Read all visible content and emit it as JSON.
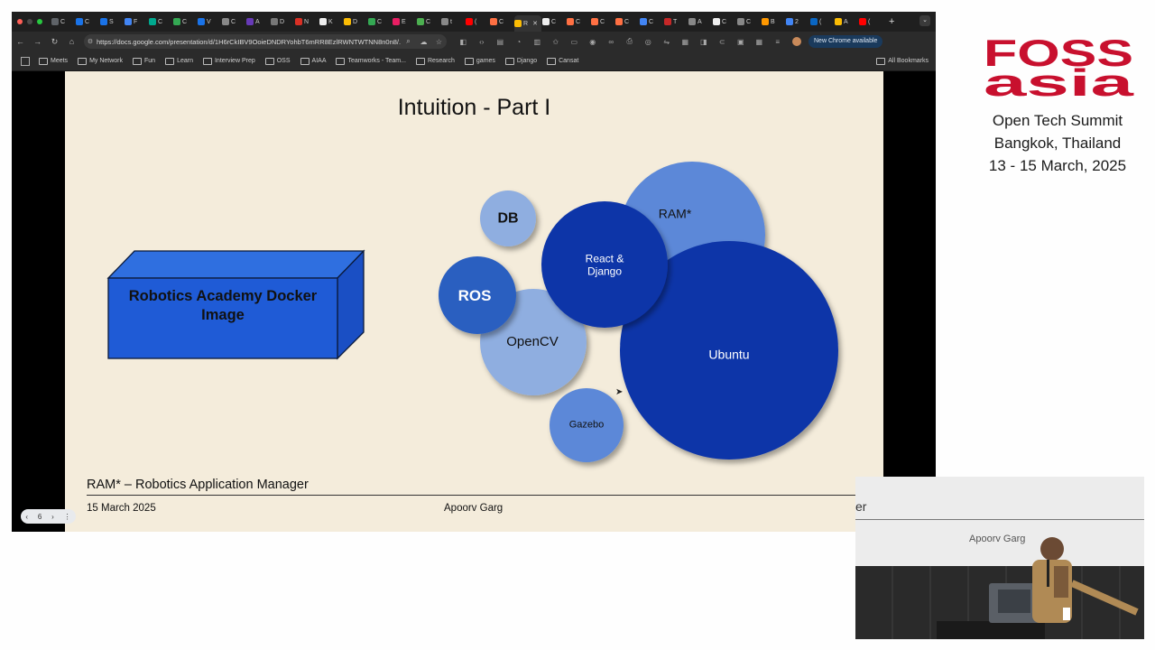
{
  "browser": {
    "tabs": [
      {
        "letter": "C",
        "color": "#5f6368"
      },
      {
        "letter": "C",
        "color": "#1a73e8"
      },
      {
        "letter": "S",
        "color": "#1a73e8"
      },
      {
        "letter": "F",
        "color": "#4285f4"
      },
      {
        "letter": "C",
        "color": "#00a98f"
      },
      {
        "letter": "C",
        "color": "#34a853"
      },
      {
        "letter": "V",
        "color": "#1a73e8"
      },
      {
        "letter": "C",
        "color": "#888888"
      },
      {
        "letter": "A",
        "color": "#673ab7"
      },
      {
        "letter": "D",
        "color": "#777777"
      },
      {
        "letter": "N",
        "color": "#d93025"
      },
      {
        "letter": "K",
        "color": "#eeeeee"
      },
      {
        "letter": "D",
        "color": "#fbbc04"
      },
      {
        "letter": "C",
        "color": "#34a853"
      },
      {
        "letter": "E",
        "color": "#e91e63"
      },
      {
        "letter": "C",
        "color": "#4caf50"
      },
      {
        "letter": "t",
        "color": "#888888"
      },
      {
        "letter": "(",
        "color": "#ff0000"
      },
      {
        "letter": "C",
        "color": "#ff7043"
      },
      {
        "letter": "R",
        "color": "#fbbc04",
        "active": true
      },
      {
        "letter": "C",
        "color": "#eeeeee"
      },
      {
        "letter": "C",
        "color": "#ff7043"
      },
      {
        "letter": "C",
        "color": "#ff7043"
      },
      {
        "letter": "C",
        "color": "#ff7043"
      },
      {
        "letter": "C",
        "color": "#4285f4"
      },
      {
        "letter": "T",
        "color": "#c62828"
      },
      {
        "letter": "A",
        "color": "#888888"
      },
      {
        "letter": "C",
        "color": "#eeeeee"
      },
      {
        "letter": "C",
        "color": "#888888"
      },
      {
        "letter": "B",
        "color": "#ff9800"
      },
      {
        "letter": "2",
        "color": "#4285f4"
      },
      {
        "letter": "(",
        "color": "#0a66c2"
      },
      {
        "letter": "A",
        "color": "#fbbc04"
      },
      {
        "letter": "(",
        "color": "#ff0000"
      }
    ],
    "new_tab": "+",
    "tab_search": "⌄",
    "url": "https://docs.google.com/presentation/d/1H6rCkIBV9OoieDNDRYohbT6mRR8EzlRWNTWTNN8n0n8/...",
    "update_label": "New Chrome available",
    "bookmarks": [
      "Meets",
      "My Network",
      "Fun",
      "Learn",
      "Interview Prep",
      "OSS",
      "AIAA",
      "Teamworks - Team...",
      "Research",
      "games",
      "Django",
      "Cansat"
    ],
    "all_bookmarks": "All Bookmarks"
  },
  "slide": {
    "title": "Intuition - Part I",
    "docker_label": "Robotics Academy Docker Image",
    "bubbles": {
      "db": "DB",
      "ram": "RAM*",
      "react": "React &\nDjango",
      "ros": "ROS",
      "opencv": "OpenCV",
      "ubuntu": "Ubuntu",
      "gazebo": "Gazebo"
    },
    "footnote": "RAM* – Robotics Application Manager",
    "date": "15 March 2025",
    "author": "Apoorv Garg"
  },
  "slide_nav": {
    "prev": "‹",
    "page": "6",
    "next": "›",
    "menu": "⋮"
  },
  "branding": {
    "logo_line1": "FOSS",
    "logo_line2": "asia",
    "event": "Open Tech Summit",
    "location": "Bangkok, Thailand",
    "dates": "13 - 15 March, 2025"
  },
  "camera": {
    "partial_text": "er",
    "author": "Apoorv Garg"
  },
  "colors": {
    "slide_bg": "#f4ecdb",
    "docker_blue": "#1f5bd6",
    "dark_blue": "#0e35a8",
    "mid_blue": "#2a5fc0",
    "light_blue": "#8faee0",
    "brand_red": "#c8102e"
  }
}
